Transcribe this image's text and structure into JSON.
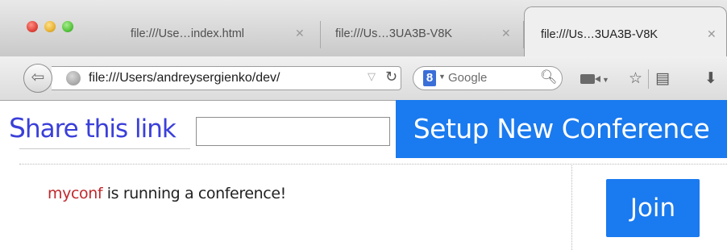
{
  "browser": {
    "tabs": [
      {
        "label": "file:///Use…index.html",
        "close": "✕",
        "active": false
      },
      {
        "label": "file:///Us…3UA3B-V8K",
        "close": "✕",
        "active": false
      },
      {
        "label": "file:///Us…3UA3B-V8K",
        "close": "✕",
        "active": true
      }
    ],
    "url": "file:///Users/andreysergienko/dev/",
    "search": {
      "engine_letter": "8",
      "placeholder": "Google"
    },
    "icons": [
      "back-arrow-icon",
      "globe-icon",
      "dropdown-icon",
      "reload-icon",
      "google-icon",
      "search-icon",
      "video-icon",
      "star-icon",
      "bookmarks-icon",
      "download-icon"
    ]
  },
  "page": {
    "share": {
      "label_first": "S",
      "label_rest": "hare this link",
      "input_value": ""
    },
    "setup_button": "Setup New Conference",
    "conference": {
      "name": "myconf",
      "message": " is running a conference!"
    },
    "join_button": "Join",
    "colors": {
      "button_blue": "#1a7aef",
      "share_label": "#3a3fd9",
      "conf_name": "#c0282d"
    }
  }
}
